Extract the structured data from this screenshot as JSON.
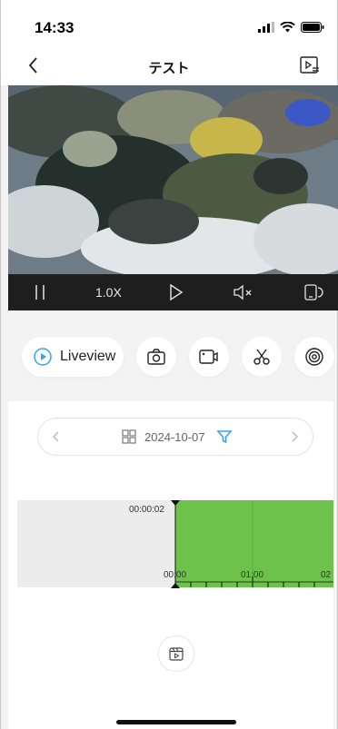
{
  "status_bar": {
    "time": "14:33"
  },
  "nav": {
    "title": "テスト"
  },
  "player_controls": {
    "speed": "1.0X"
  },
  "actions": {
    "liveview_label": "Liveview"
  },
  "date_selector": {
    "date": "2024-10-07"
  },
  "timeline": {
    "current_time": "00:00:02",
    "tick_start": "00:00",
    "tick_mid": "01:00",
    "tick_end": "02"
  },
  "colors": {
    "accent": "#3a9ff0",
    "timeline_recorded": "#6cc24a",
    "timeline_empty": "#ececec",
    "control_bar": "#1e1e1e"
  }
}
